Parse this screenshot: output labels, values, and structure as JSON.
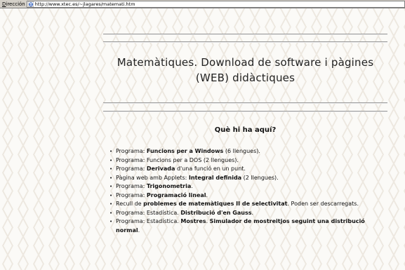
{
  "addressbar": {
    "label_prefix": "D",
    "label_rest": "irección",
    "url": "http://www.xtec.es/~jlagares/matemati.htm"
  },
  "page": {
    "title_line1": "Matemàtiques. Download de software i pàgines",
    "title_line2": "(WEB) didàctiques",
    "section_heading": "Què hi ha aquí?",
    "items": [
      {
        "parts": [
          {
            "t": "Programa: "
          },
          {
            "t": "Funcions per a Windows",
            "b": true
          },
          {
            "t": " (6 llengues)."
          }
        ]
      },
      {
        "parts": [
          {
            "t": "Programa: Funcions per a DOS (2 llengues)."
          }
        ]
      },
      {
        "parts": [
          {
            "t": "Programa: "
          },
          {
            "t": "Derivada",
            "b": true
          },
          {
            "t": " d'una funció en un punt."
          }
        ]
      },
      {
        "parts": [
          {
            "t": "Pàgina web amb Applets: "
          },
          {
            "t": "Integral definida",
            "b": true
          },
          {
            "t": " (2 llengues)."
          }
        ]
      },
      {
        "parts": [
          {
            "t": "Programa: "
          },
          {
            "t": "Trigonometria",
            "b": true
          },
          {
            "t": "."
          }
        ]
      },
      {
        "parts": [
          {
            "t": "Programa: "
          },
          {
            "t": "Programació lineal",
            "b": true
          },
          {
            "t": "."
          }
        ]
      },
      {
        "parts": [
          {
            "t": "Recull de "
          },
          {
            "t": "problemes de matemàtiques II de selectivitat",
            "b": true
          },
          {
            "t": ". Poden ser descarregats."
          }
        ]
      },
      {
        "parts": [
          {
            "t": "Programa: Estadística. "
          },
          {
            "t": "Distribució d'en Gauss",
            "b": true
          },
          {
            "t": "."
          }
        ]
      },
      {
        "parts": [
          {
            "t": "Programa: Estadística. "
          },
          {
            "t": "Mostres",
            "b": true
          },
          {
            "t": ". "
          },
          {
            "t": "Simulador de mostreitjos seguint una distribució normal",
            "b": true
          },
          {
            "t": "."
          }
        ]
      }
    ]
  },
  "icons": {
    "page_icon": "ie-page-icon",
    "bullet": "•"
  }
}
